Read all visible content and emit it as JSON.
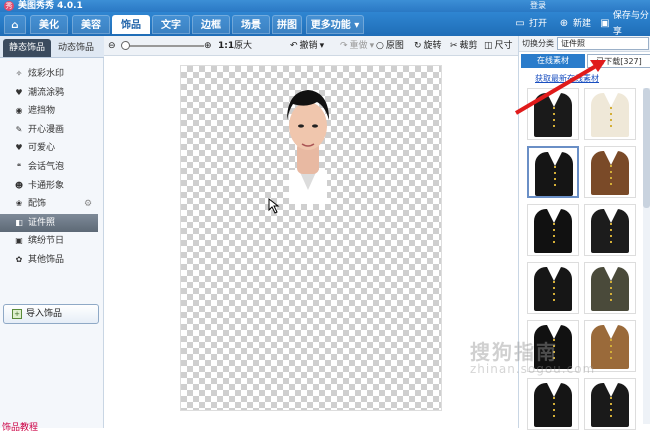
{
  "app": {
    "title": "美图秀秀 4.0.1",
    "login": "登录"
  },
  "tabs": [
    {
      "label": "美化"
    },
    {
      "label": "美容"
    },
    {
      "label": "饰品"
    },
    {
      "label": "文字"
    },
    {
      "label": "边框"
    },
    {
      "label": "场景"
    },
    {
      "label": "拼图"
    },
    {
      "label": "更多功能"
    }
  ],
  "top_actions": {
    "open": "打开",
    "new": "新建",
    "save": "保存与分享"
  },
  "left": {
    "subtabs": [
      "静态饰品",
      "动态饰品"
    ],
    "categories": [
      {
        "label": "炫彩水印",
        "icon": "✧"
      },
      {
        "label": "潮流涂鸦",
        "icon": "♥"
      },
      {
        "label": "遮挡物",
        "icon": "◉"
      },
      {
        "label": "开心漫画",
        "icon": "✎"
      },
      {
        "label": "可爱心",
        "icon": "♥"
      },
      {
        "label": "会话气泡",
        "icon": "❝"
      },
      {
        "label": "卡通形象",
        "icon": "☻"
      },
      {
        "label": "配饰",
        "icon": "❀"
      },
      {
        "label": "证件照",
        "icon": "◧"
      },
      {
        "label": "缤纷节日",
        "icon": "▣"
      },
      {
        "label": "其他饰品",
        "icon": "✿"
      }
    ],
    "selected_index": 8,
    "import_label": "导入饰品",
    "bottom_text": "饰品教程"
  },
  "toolbar": {
    "zoom_label": "1:1",
    "original_label": "原大",
    "undo": "撤销",
    "redo": "重做",
    "compare": "原图",
    "rotate": "旋转",
    "crop": "裁剪",
    "size": "尺寸"
  },
  "right": {
    "switch_label": "切换分类",
    "category_value": "证件照",
    "tab_online": "在线素材",
    "tab_downloaded": "已下载[327]",
    "link": "获取最新在线素材",
    "colors": {
      "uniforms": [
        "#1a1a1a",
        "#efe8d8",
        "#151515",
        "#7a4a28",
        "#111111",
        "#1c1c1c",
        "#161616",
        "#4a4a3a",
        "#111111",
        "#9a6a3a",
        "#151515",
        "#1a1a1a"
      ]
    }
  },
  "watermark": {
    "line1": "搜狗指南",
    "line2": "zhinan.sogou.com"
  },
  "colors": {
    "accent": "#2a7ccb",
    "annotation_arrow": "#e01b1b"
  }
}
